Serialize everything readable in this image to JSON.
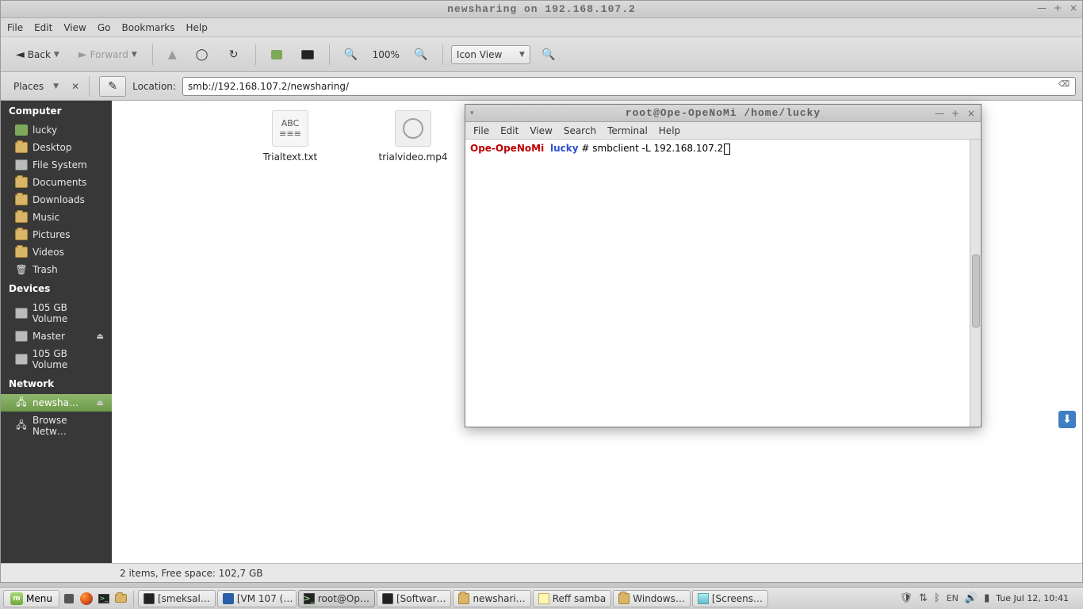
{
  "fm": {
    "title": "newsharing on 192.168.107.2",
    "menubar": [
      "File",
      "Edit",
      "View",
      "Go",
      "Bookmarks",
      "Help"
    ],
    "toolbar": {
      "back": "Back",
      "forward": "Forward",
      "zoom": "100%",
      "viewmode": "Icon View"
    },
    "places_label": "Places",
    "location_label": "Location:",
    "location_value": "smb://192.168.107.2/newsharing/",
    "sidebar": {
      "computer_hdr": "Computer",
      "computer": [
        {
          "icon": "home",
          "label": "lucky"
        },
        {
          "icon": "folder",
          "label": "Desktop"
        },
        {
          "icon": "drive",
          "label": "File System"
        },
        {
          "icon": "folder",
          "label": "Documents"
        },
        {
          "icon": "folder",
          "label": "Downloads"
        },
        {
          "icon": "folder",
          "label": "Music"
        },
        {
          "icon": "folder",
          "label": "Pictures"
        },
        {
          "icon": "folder",
          "label": "Videos"
        },
        {
          "icon": "trash",
          "label": "Trash"
        }
      ],
      "devices_hdr": "Devices",
      "devices": [
        {
          "icon": "drive",
          "label": "105 GB Volume"
        },
        {
          "icon": "drive",
          "label": "Master",
          "eject": true
        },
        {
          "icon": "drive",
          "label": "105 GB Volume"
        }
      ],
      "network_hdr": "Network",
      "network": [
        {
          "icon": "share",
          "label": "newsha…",
          "eject": true,
          "active": true
        },
        {
          "icon": "share",
          "label": "Browse Netw…"
        }
      ]
    },
    "files": [
      {
        "name": "Trialtext.txt",
        "type": "text"
      },
      {
        "name": "trialvideo.mp4",
        "type": "video"
      }
    ],
    "status": "2 items, Free space: 102,7 GB"
  },
  "terminal": {
    "title": "root@Ope-OpeNoMi /home/lucky",
    "menubar": [
      "File",
      "Edit",
      "View",
      "Search",
      "Terminal",
      "Help"
    ],
    "prompt_host": "Ope-OpeNoMi",
    "prompt_dir": "lucky",
    "prompt_sep": " # ",
    "command": "smbclient -L 192.168.107.2"
  },
  "taskbar": {
    "menu": "Menu",
    "items": [
      {
        "icon": "monitor",
        "label": "[smeksal…"
      },
      {
        "icon": "vbox",
        "label": "[VM 107 (…"
      },
      {
        "icon": "term",
        "label": "root@Op…",
        "active": true
      },
      {
        "icon": "monitor",
        "label": "[Softwar…"
      },
      {
        "icon": "folder",
        "label": "newshari…"
      },
      {
        "icon": "note",
        "label": "Reff samba"
      },
      {
        "icon": "folder",
        "label": "Windows…"
      },
      {
        "icon": "img",
        "label": "[Screens…"
      }
    ],
    "lang": "EN",
    "clock": "Tue Jul 12, 10:41"
  }
}
